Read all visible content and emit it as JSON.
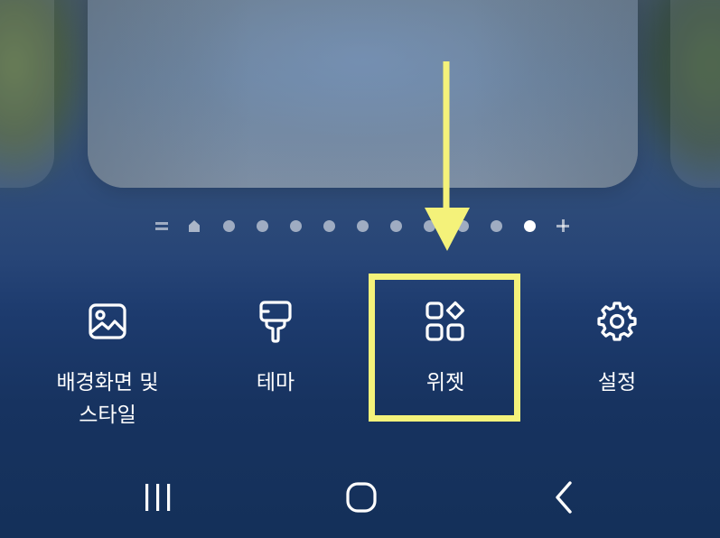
{
  "wallpaper_menu": {
    "items": [
      {
        "label": "배경화면 및\n스타일",
        "icon": "image-icon"
      },
      {
        "label": "테마",
        "icon": "paintbrush-icon"
      },
      {
        "label": "위젯",
        "icon": "widgets-icon"
      },
      {
        "label": "설정",
        "icon": "gear-icon"
      }
    ]
  },
  "page_indicator": {
    "items": [
      "list-icon",
      "home-icon",
      "dot",
      "dot",
      "dot",
      "dot",
      "dot",
      "dot",
      "dot",
      "dot",
      "dot",
      "dot-active",
      "add-page-icon"
    ],
    "active_index": 11
  },
  "navigation_bar": {
    "buttons": [
      "recent-apps-icon",
      "home-icon",
      "back-icon"
    ]
  },
  "annotation": {
    "highlight_color": "#f4f27a",
    "highlighted_item": "위젯"
  },
  "colors": {
    "background_top": "#43566a",
    "background_bottom": "#143059",
    "icon_color": "#ffffff"
  }
}
